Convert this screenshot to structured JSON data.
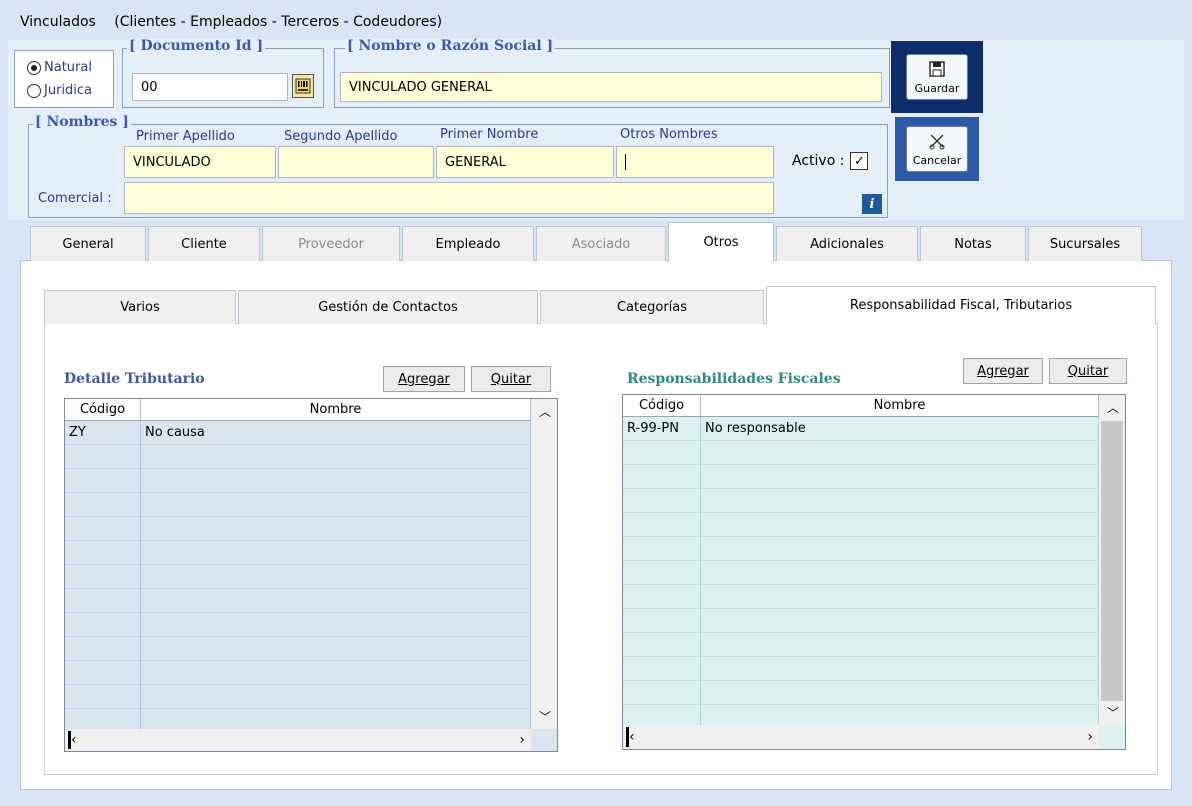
{
  "window": {
    "title": "Vinculados",
    "subtitle": "(Clientes - Empleados - Terceros - Codeudores)"
  },
  "person_type": {
    "natural": "Natural",
    "juridica": "Juridica",
    "selected": "natural"
  },
  "documento": {
    "legend": "[ Documento Id ]",
    "value": "00"
  },
  "razon_social": {
    "legend": "[ Nombre o Razón Social ]",
    "value": "VINCULADO GENERAL"
  },
  "actions": {
    "save_label": "Guardar",
    "cancel_label": "Cancelar"
  },
  "nombres": {
    "legend": "[ Nombres ]",
    "primer_apellido_label": "Primer Apellido",
    "primer_apellido": "VINCULADO",
    "segundo_apellido_label": "Segundo Apellido",
    "segundo_apellido": "",
    "primer_nombre_label": "Primer Nombre",
    "primer_nombre": "GENERAL",
    "otros_nombres_label": "Otros Nombres",
    "otros_nombres": "",
    "activo_label": "Activo :",
    "activo": true,
    "comercial_label": "Comercial :",
    "comercial": ""
  },
  "main_tabs": [
    {
      "label": "General",
      "state": "normal"
    },
    {
      "label": "Cliente",
      "state": "normal"
    },
    {
      "label": "Proveedor",
      "state": "disabled"
    },
    {
      "label": "Empleado",
      "state": "normal"
    },
    {
      "label": "Asociado",
      "state": "disabled"
    },
    {
      "label": "Otros",
      "state": "active"
    },
    {
      "label": "Adicionales",
      "state": "normal"
    },
    {
      "label": "Notas",
      "state": "normal"
    },
    {
      "label": "Sucursales",
      "state": "normal"
    }
  ],
  "sub_tabs": [
    {
      "label": "Varios",
      "state": "normal"
    },
    {
      "label": "Gestión de Contactos",
      "state": "normal"
    },
    {
      "label": "Categorías",
      "state": "normal"
    },
    {
      "label": "Responsabilidad Fiscal, Tributarios",
      "state": "active"
    }
  ],
  "detalle_tributario": {
    "title": "Detalle Tributario",
    "title_color": "#3a5aa8",
    "add_label": "Agregar",
    "remove_label": "Quitar",
    "columns": [
      "Código",
      "Nombre"
    ],
    "rows": [
      {
        "codigo": "ZY",
        "nombre": "No causa"
      }
    ]
  },
  "responsabilidades": {
    "title": "Responsabilidades Fiscales",
    "title_color": "#2a8a8a",
    "add_label": "Agregar",
    "remove_label": "Quitar",
    "columns": [
      "Código",
      "Nombre"
    ],
    "rows": [
      {
        "codigo": "R-99-PN",
        "nombre": "No responsable"
      }
    ]
  }
}
